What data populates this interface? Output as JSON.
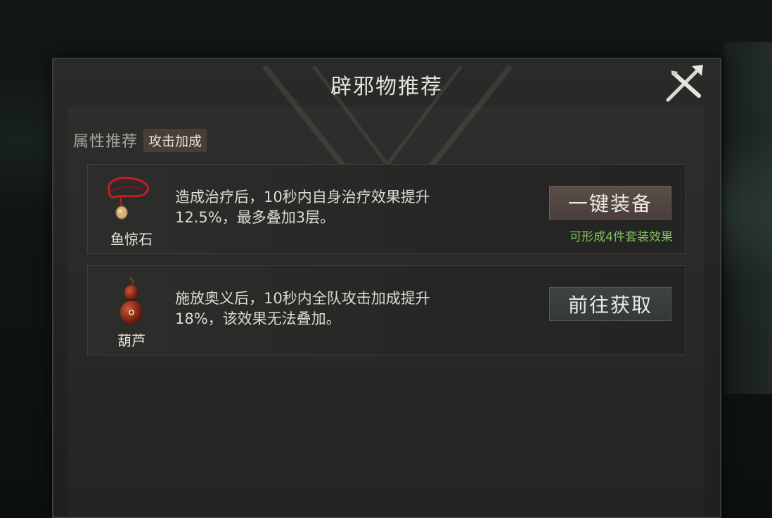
{
  "dialog": {
    "title": "辟邪物推荐",
    "close_icon": "close-x-icon"
  },
  "attribute": {
    "label": "属性推荐",
    "tag": "攻击加成"
  },
  "items": [
    {
      "name": "鱼惊石",
      "icon": "red-cord-pendant-icon",
      "description_line1": "造成治疗后，10秒内自身治疗效果提升",
      "description_line2": "12.5%，最多叠加3层。",
      "button_label": "一键装备",
      "hint": "可形成4件套装效果"
    },
    {
      "name": "葫芦",
      "icon": "gourd-icon",
      "description_line1": "施放奥义后，10秒内全队攻击加成提升",
      "description_line2": "18%，该效果无法叠加。",
      "button_label": "前往获取"
    }
  ],
  "colors": {
    "hint_green": "#7fc25a",
    "equip_button": "#564a44",
    "get_button": "#3a4040",
    "tag_bg": "#4b3e39"
  }
}
